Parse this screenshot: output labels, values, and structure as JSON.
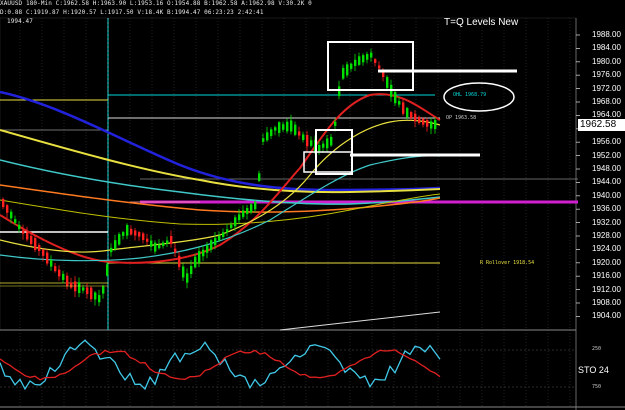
{
  "header": {
    "line1": "XAUUSD 180-Min  C:1962.58 H:1963.90  L:1953.16  O:1954.88  B:1962.58  A:1962.98  V:30.2K  0",
    "line2": "D:0.88  C:1919.87  H:1920.57  L:1917.50  V:18.4K  B:1994.47  06:23:23  2:42:41",
    "line3": "1994.47"
  },
  "title": "T=Q Levels New",
  "price_axis": [
    "1988.00",
    "1984.00",
    "1980.00",
    "1976.00",
    "1972.00",
    "1968.00",
    "1964.00",
    "1960.00",
    "1956.00",
    "1952.00",
    "1948.00",
    "1944.00",
    "1940.00",
    "1936.00",
    "1932.00",
    "1928.00",
    "1924.00",
    "1920.00",
    "1916.00",
    "1912.00",
    "1908.00",
    "1904.00"
  ],
  "current_price": "1962.58",
  "annotations": {
    "ohlc_label": "OHL 1968.79",
    "op_label": "OP 1963.58",
    "rollover_label": "R Rollover 1918.54"
  },
  "indicator": {
    "name": "STO",
    "value": "24",
    "levels": [
      "750",
      "250"
    ]
  },
  "colors": {
    "bull": "#00e000",
    "bear": "#ff2020",
    "ma_blue": "#2222dd",
    "ma_cyan": "#40c8c8",
    "ma_yellow": "#e8e040",
    "ma_orange": "#ff7a20",
    "ma_red": "#e02020",
    "magenta": "#d020d0",
    "accent_cyan": "#00d8d8"
  }
}
